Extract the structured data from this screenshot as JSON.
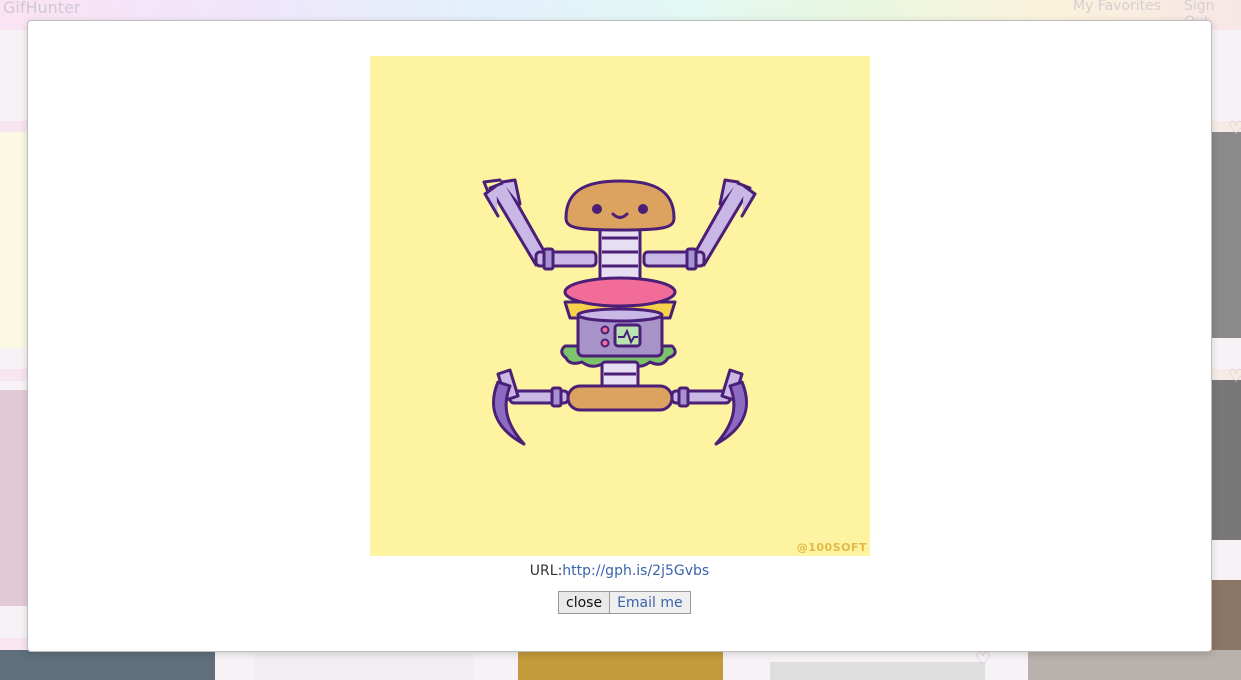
{
  "navbar": {
    "brand": "GifHunter",
    "links": [
      "My Favorites",
      "Sign Out"
    ]
  },
  "modal": {
    "gif": {
      "alt": "hamburger robot",
      "watermark": "@100SOFT",
      "background_color": "#fdf3a0"
    },
    "url_label": "URL:",
    "url": "http://gph.is/2j5Gvbs",
    "buttons": {
      "close": "close",
      "email": "Email me"
    }
  },
  "icons": [
    "heart-icon"
  ]
}
